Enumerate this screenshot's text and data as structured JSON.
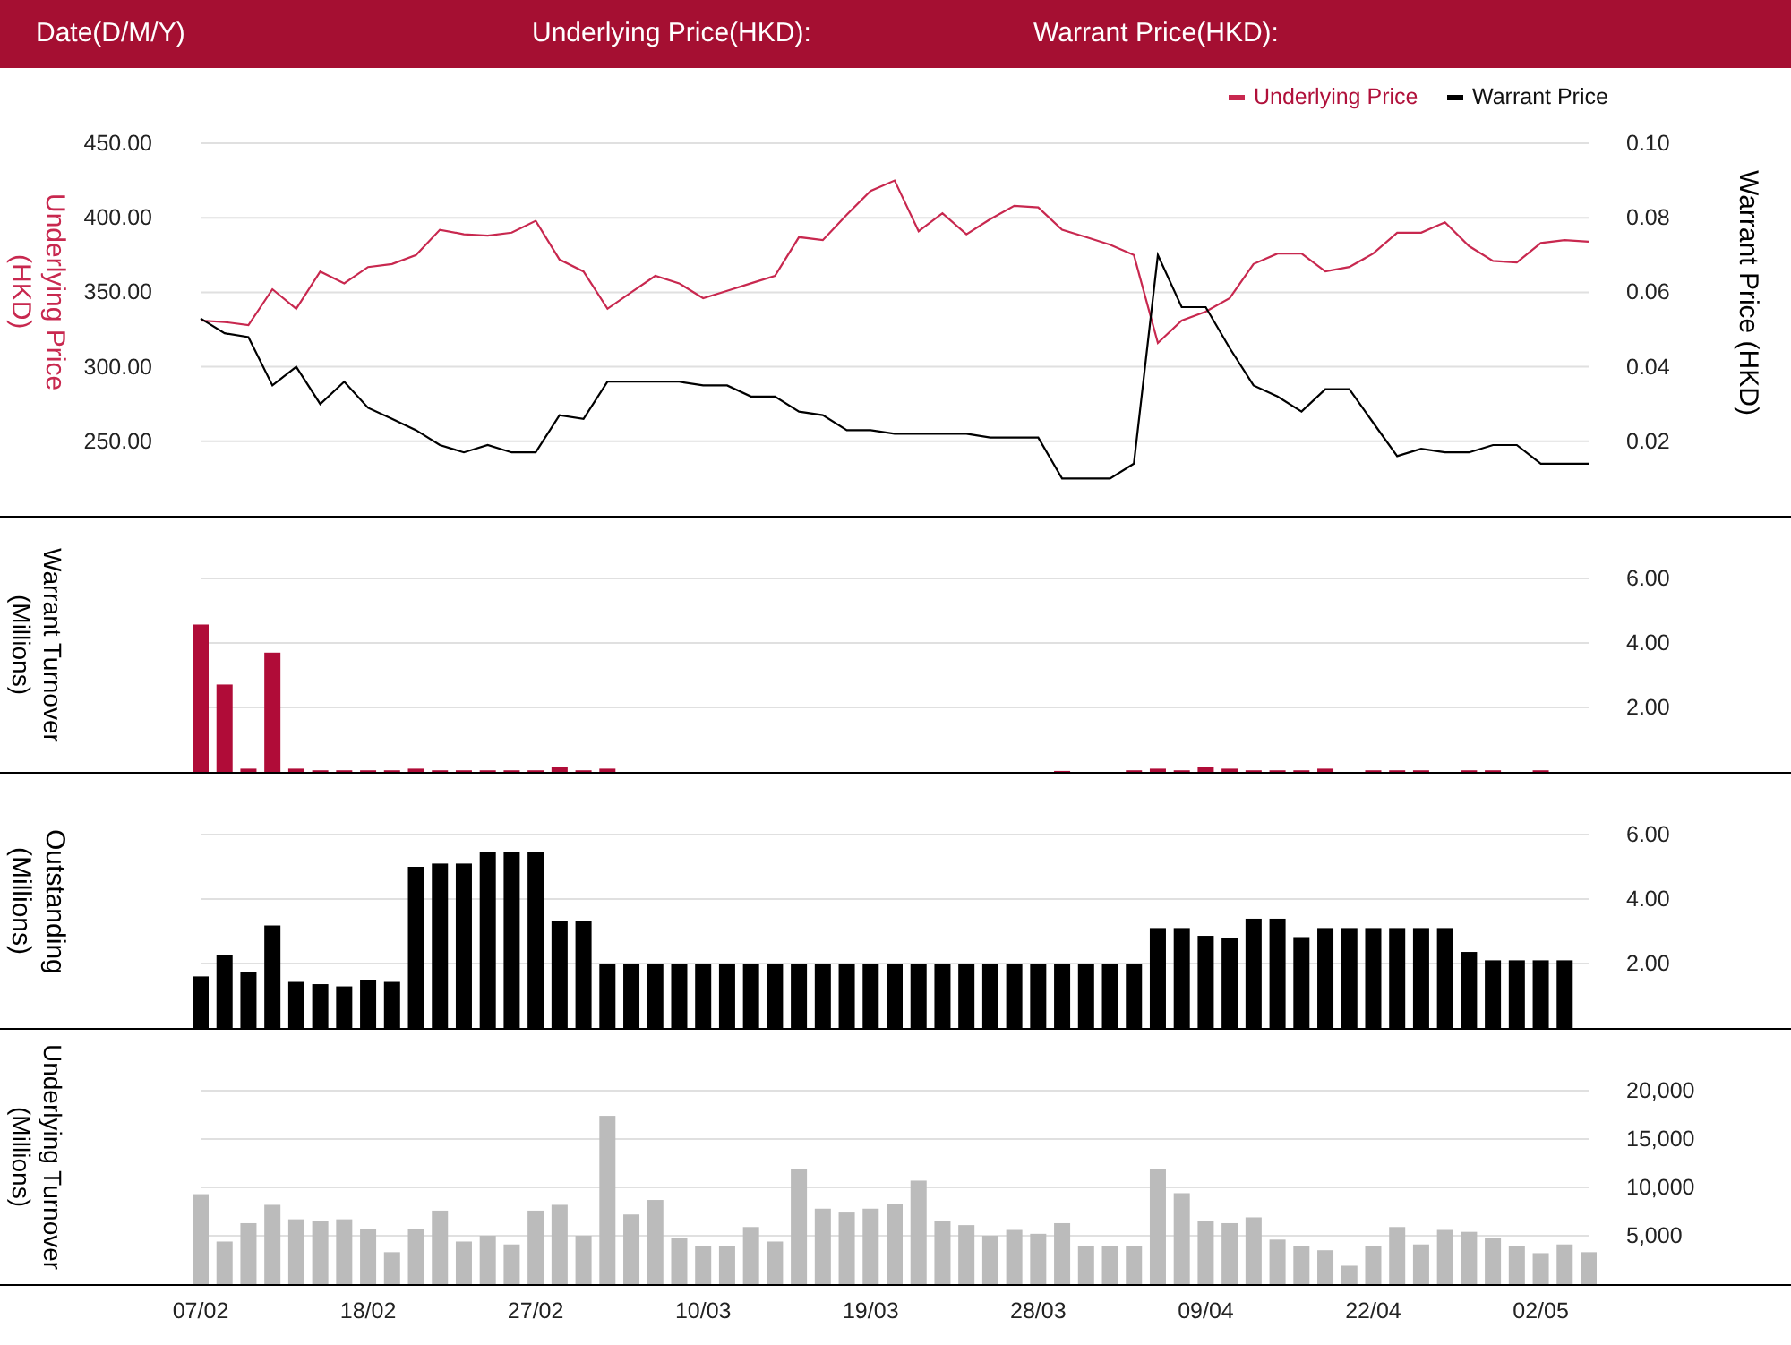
{
  "header": {
    "labels": [
      "Date(D/M/Y)",
      "Underlying Price(HKD):",
      "Warrant Price(HKD):"
    ]
  },
  "price_chart": {
    "chart_data": {
      "type": "line",
      "grid": true,
      "legend": "top-right",
      "ylabel": "Underlying Price (HKD)",
      "y2label": "Warrant Price (HKD)",
      "ylim": [
        200,
        450
      ],
      "y2lim": [
        0,
        0.1
      ],
      "yticks": [
        {
          "value": 450,
          "label": "450.00"
        },
        {
          "value": 400,
          "label": "400.00"
        },
        {
          "value": 350,
          "label": "350.00"
        },
        {
          "value": 300,
          "label": "300.00"
        },
        {
          "value": 250,
          "label": "250.00"
        }
      ],
      "y2ticks": [
        {
          "value": 0.1,
          "label": "0.10"
        },
        {
          "value": 0.08,
          "label": "0.08"
        },
        {
          "value": 0.06,
          "label": "0.06"
        },
        {
          "value": 0.04,
          "label": "0.04"
        },
        {
          "value": 0.02,
          "label": "0.02"
        }
      ],
      "series": [
        {
          "name": "Underlying Price",
          "color": "#c8284f",
          "values": [
            331,
            330,
            328,
            352,
            339,
            364,
            356,
            367,
            369,
            375,
            392,
            389,
            388,
            390,
            398,
            372,
            364,
            339,
            350,
            361,
            356,
            346,
            351,
            356,
            361,
            387,
            385,
            402,
            418,
            425,
            391,
            403,
            389,
            399,
            408,
            407,
            392,
            387,
            382,
            375,
            316,
            331,
            337,
            346,
            369,
            376,
            376,
            364,
            367,
            376,
            390,
            390,
            397,
            381,
            371,
            370,
            383,
            385,
            384
          ]
        },
        {
          "name": "Warrant Price",
          "color": "#000000",
          "axis": "y2",
          "values": [
            0.053,
            0.049,
            0.048,
            0.035,
            0.04,
            0.03,
            0.036,
            0.029,
            0.026,
            0.023,
            0.019,
            0.017,
            0.019,
            0.017,
            0.017,
            0.027,
            0.026,
            0.036,
            0.036,
            0.036,
            0.036,
            0.035,
            0.035,
            0.032,
            0.032,
            0.028,
            0.027,
            0.023,
            0.023,
            0.022,
            0.022,
            0.022,
            0.022,
            0.021,
            0.021,
            0.021,
            0.01,
            0.01,
            0.01,
            0.014,
            0.07,
            0.056,
            0.056,
            0.045,
            0.035,
            0.032,
            0.028,
            0.034,
            0.034,
            0.025,
            0.016,
            0.018,
            0.017,
            0.017,
            0.019,
            0.019,
            0.014,
            0.014,
            0.014
          ]
        }
      ]
    }
  },
  "warrant_turnover_chart": {
    "chart_data": {
      "type": "bar",
      "grid": true,
      "ylabel": "Warrant Turnover (Millions)",
      "ylim": [
        0,
        6
      ],
      "yticks": [
        {
          "value": 6,
          "label": "6.00"
        },
        {
          "value": 4,
          "label": "4.00"
        },
        {
          "value": 2,
          "label": "2.00"
        }
      ],
      "series": [
        {
          "color": "#b00c38",
          "values": [
            4.57,
            2.71,
            0.1,
            3.7,
            0.1,
            0.05,
            0.05,
            0.05,
            0.05,
            0.1,
            0.05,
            0.05,
            0.05,
            0.05,
            0.05,
            0.15,
            0.05,
            0.1,
            0,
            0,
            0,
            0,
            0,
            0,
            0,
            0,
            0,
            0,
            0,
            0,
            0,
            0,
            0,
            0,
            0,
            0,
            0.03,
            0,
            0,
            0.05,
            0.1,
            0.05,
            0.15,
            0.1,
            0.05,
            0.05,
            0.05,
            0.1,
            0,
            0.05,
            0.05,
            0.05,
            0,
            0.05,
            0.05,
            0,
            0.05,
            0,
            0
          ]
        }
      ]
    }
  },
  "outstanding_chart": {
    "chart_data": {
      "type": "bar",
      "grid": true,
      "ylabel": "Outstanding (Millions)",
      "ylim": [
        0,
        6
      ],
      "yticks": [
        {
          "value": 6,
          "label": "6.00"
        },
        {
          "value": 4,
          "label": "4.00"
        },
        {
          "value": 2,
          "label": "2.00"
        }
      ],
      "series": [
        {
          "color": "#000000",
          "values": [
            1.6,
            2.25,
            1.75,
            3.18,
            1.43,
            1.36,
            1.29,
            1.5,
            1.43,
            5.0,
            5.1,
            5.1,
            5.46,
            5.46,
            5.46,
            3.32,
            3.32,
            2,
            2,
            2,
            2,
            2,
            2,
            2,
            2,
            2,
            2,
            2,
            2,
            2,
            2,
            2,
            2,
            2,
            2,
            2,
            2,
            2,
            2,
            2,
            3.1,
            3.1,
            2.86,
            2.79,
            3.39,
            3.39,
            2.82,
            3.1,
            3.1,
            3.1,
            3.1,
            3.1,
            3.1,
            2.36,
            2.1,
            2.1,
            2.1,
            2.1,
            null
          ]
        }
      ]
    }
  },
  "underlying_turnover_chart": {
    "chart_data": {
      "type": "bar",
      "grid": true,
      "ylabel": "Underlying Turnover (Millions)",
      "ylim": [
        0,
        20000
      ],
      "yticks": [
        {
          "value": 20000,
          "label": "20,000"
        },
        {
          "value": 15000,
          "label": "15,000"
        },
        {
          "value": 10000,
          "label": "10,000"
        },
        {
          "value": 5000,
          "label": "5,000"
        }
      ],
      "categories": [
        "07/02",
        null,
        null,
        null,
        null,
        null,
        null,
        "18/02",
        null,
        null,
        null,
        null,
        null,
        null,
        "27/02",
        null,
        null,
        null,
        null,
        null,
        null,
        "10/03",
        null,
        null,
        null,
        null,
        null,
        null,
        "19/03",
        null,
        null,
        null,
        null,
        null,
        null,
        "28/03",
        null,
        null,
        null,
        null,
        null,
        null,
        "09/04",
        null,
        null,
        null,
        null,
        null,
        null,
        "22/04",
        null,
        null,
        null,
        null,
        null,
        null,
        "02/05",
        null,
        null
      ],
      "series": [
        {
          "color": "#bbbbbb",
          "values": [
            9300,
            4400,
            6300,
            8200,
            6700,
            6500,
            6700,
            5700,
            3300,
            5700,
            7600,
            4400,
            5000,
            4100,
            7600,
            8200,
            5000,
            17400,
            7200,
            8700,
            4800,
            3900,
            3900,
            5900,
            4400,
            11900,
            7800,
            7400,
            7800,
            8300,
            10700,
            6500,
            6100,
            5000,
            5600,
            5200,
            6300,
            3900,
            3900,
            3900,
            11900,
            9400,
            6500,
            6300,
            6900,
            4600,
            3900,
            3500,
            1900,
            3900,
            5900,
            4100,
            5600,
            5400,
            4800,
            3900,
            3200,
            4100,
            3300
          ]
        }
      ]
    }
  }
}
